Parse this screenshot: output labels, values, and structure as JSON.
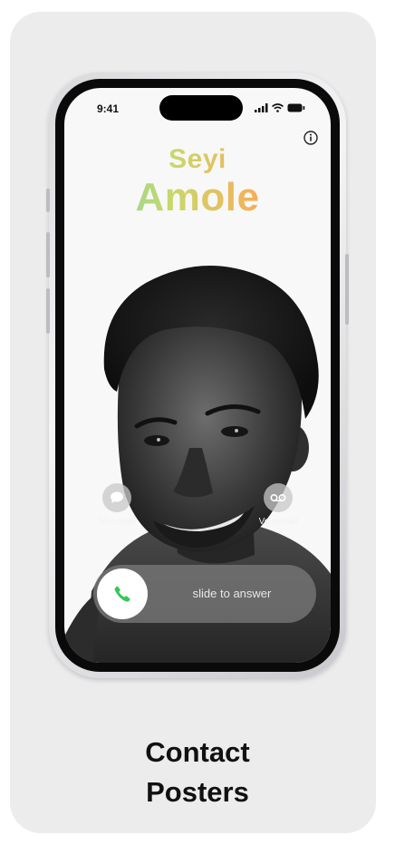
{
  "status_bar": {
    "time": "9:41",
    "icons": [
      "cellular-signal-icon",
      "wifi-icon",
      "battery-icon"
    ]
  },
  "contact": {
    "first_name": "Seyi",
    "last_name": "Amole",
    "name_gradient": [
      "#6fd3c5",
      "#c8d86a",
      "#f3b25a",
      "#ef6d60"
    ]
  },
  "actions": {
    "message": {
      "label": "Message",
      "icon": "message-bubble-icon"
    },
    "voicemail": {
      "label": "Voicemail",
      "icon": "voicemail-icon"
    }
  },
  "answer": {
    "label": "slide to answer",
    "icon": "phone-icon",
    "icon_color": "#34c759"
  },
  "caption": {
    "line1": "Contact",
    "line2": "Posters"
  }
}
